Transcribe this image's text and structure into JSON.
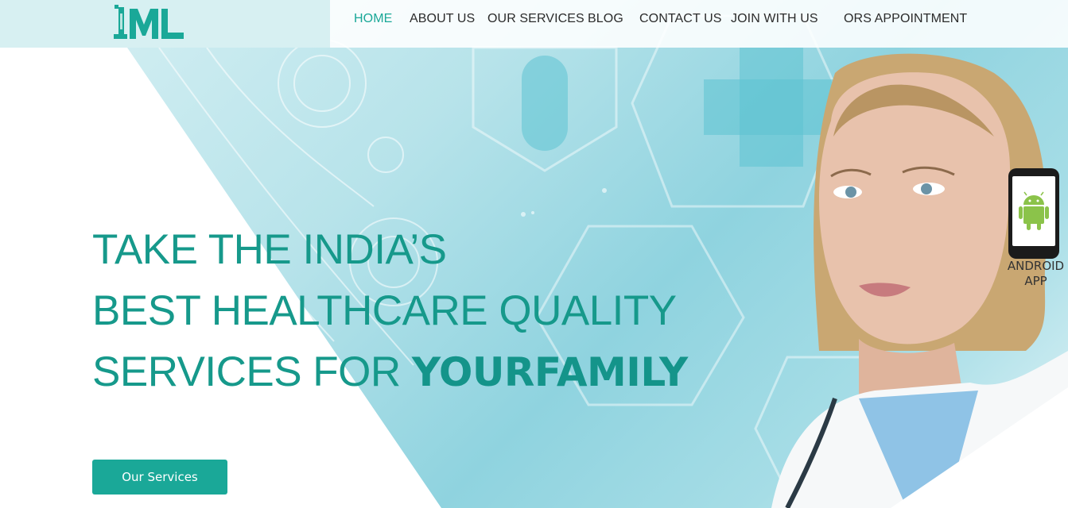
{
  "nav": {
    "items": [
      {
        "label": "HOME",
        "active": true
      },
      {
        "label": "ABOUT US",
        "active": false
      },
      {
        "label": "OUR SERVICES",
        "active": false
      },
      {
        "label": "BLOG",
        "active": false
      },
      {
        "label": "CONTACT US",
        "active": false
      },
      {
        "label": "JOIN WITH US",
        "active": false
      },
      {
        "label": "ORS APPOINTMENT",
        "active": false
      }
    ]
  },
  "logo": {
    "text": "1ML"
  },
  "hero": {
    "line1": "TAKE THE INDIA’S",
    "line2": "BEST HEALTHCARE QUALITY",
    "line3_prefix": "SERVICES FOR ",
    "line3_bold": "YOURFAMILY",
    "cta_label": "Our Services"
  },
  "android": {
    "line1": "ANDROID",
    "line2": "APP",
    "icon": "android-icon"
  },
  "colors": {
    "accent": "#1aa898",
    "headline": "#16998b",
    "header_left": "#d7f0f2"
  }
}
